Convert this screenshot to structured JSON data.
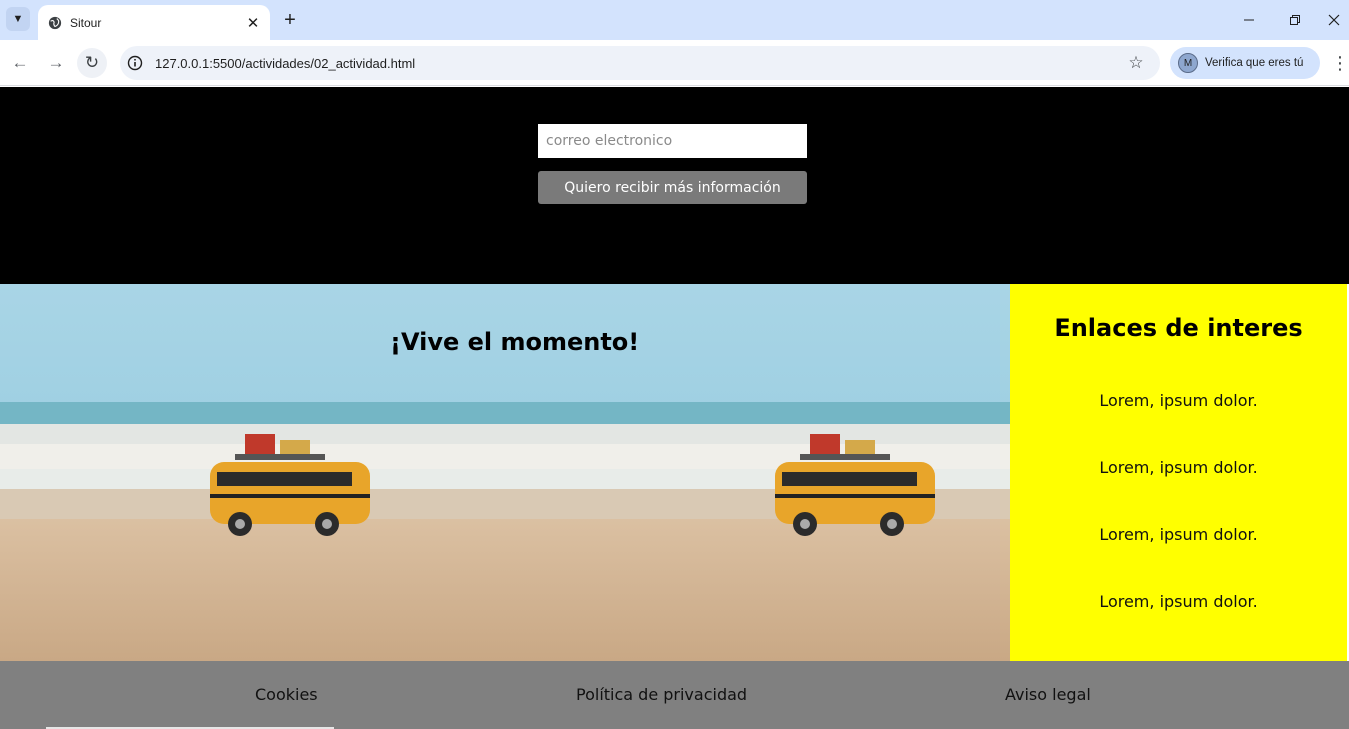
{
  "browser": {
    "tab_title": "Sitour",
    "url": "127.0.0.1:5500/actividades/02_actividad.html",
    "profile_label": "Verifica que eres tú",
    "profile_initial": "M"
  },
  "signup": {
    "email_placeholder": "correo electronico",
    "button_label": "Quiero recibir más información"
  },
  "banner": {
    "title": "¡Vive el momento!"
  },
  "aside": {
    "title": "Enlaces de interes",
    "links": [
      "Lorem, ipsum dolor.",
      "Lorem, ipsum dolor.",
      "Lorem, ipsum dolor.",
      "Lorem, ipsum dolor."
    ]
  },
  "footer": {
    "links": [
      "Cookies",
      "Política de privacidad",
      "Aviso legal"
    ]
  },
  "colors": {
    "header_bg": "#000000",
    "aside_bg": "#ffff00",
    "footer_bg": "#808080",
    "button_bg": "#7a7a7a"
  }
}
